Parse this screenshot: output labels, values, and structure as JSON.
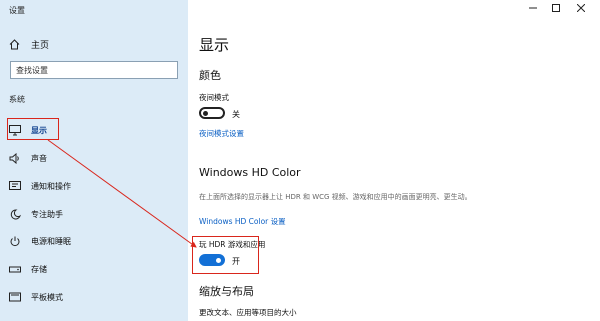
{
  "window": {
    "title": "设置",
    "controls": [
      "minimize-icon",
      "maximize-icon",
      "close-icon"
    ]
  },
  "sidebar": {
    "home_label": "主页",
    "search_placeholder": "查找设置",
    "section_label": "系统",
    "items": [
      {
        "label": "显示",
        "icon": "monitor-icon",
        "active": true
      },
      {
        "label": "声音",
        "icon": "speaker-icon"
      },
      {
        "label": "通知和操作",
        "icon": "notification-icon"
      },
      {
        "label": "专注助手",
        "icon": "moon-icon"
      },
      {
        "label": "电源和睡眠",
        "icon": "power-icon"
      },
      {
        "label": "存储",
        "icon": "storage-icon"
      },
      {
        "label": "平板模式",
        "icon": "tablet-icon"
      }
    ]
  },
  "main": {
    "page_title": "显示",
    "color_section": {
      "heading": "颜色",
      "night_light_label": "夜间模式",
      "night_light_state": "关",
      "night_light_on": false,
      "night_light_settings_link": "夜间模式设置"
    },
    "hdr_section": {
      "heading": "Windows HD Color",
      "description": "在上面所选择的显示器上让 HDR 和 WCG 视频、游戏和应用中的画面更明亮、更生动。",
      "settings_link": "Windows HD Color 设置",
      "toggle_label": "玩 HDR 游戏和应用",
      "toggle_state": "开",
      "toggle_on": true
    },
    "layout_section": {
      "heading": "缩放与布局",
      "scale_label": "更改文本、应用等项目的大小"
    }
  },
  "colors": {
    "sidebar_bg": "#dcebf7",
    "accent": "#1370d6",
    "link": "#0a5fc4",
    "annotation": "#d9261c"
  }
}
